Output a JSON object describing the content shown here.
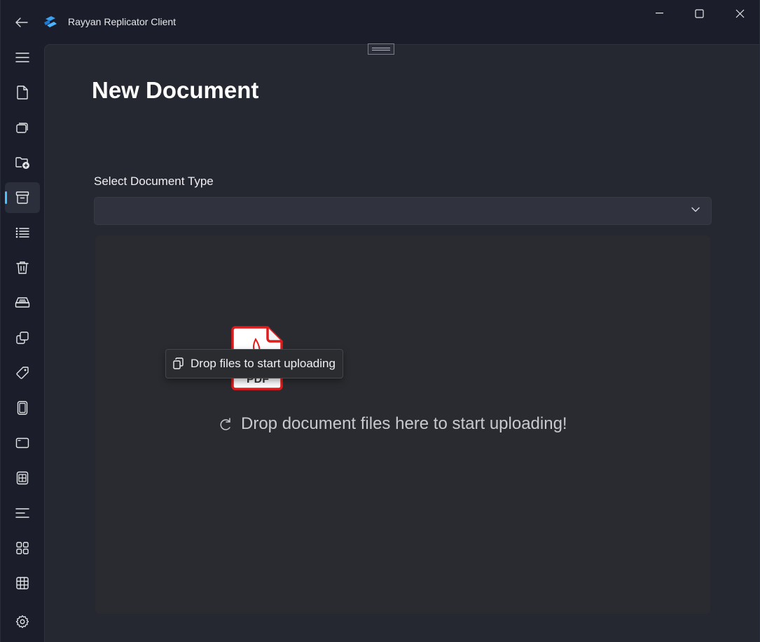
{
  "window": {
    "title": "Rayyan Replicator Client"
  },
  "sidebar": {
    "items": [
      {
        "icon": "hamburger-menu-icon"
      },
      {
        "icon": "document-icon"
      },
      {
        "icon": "documents-stack-icon"
      },
      {
        "icon": "folder-add-icon"
      },
      {
        "icon": "archive-icon",
        "active": true
      },
      {
        "icon": "bulleted-list-icon"
      },
      {
        "icon": "trash-icon"
      },
      {
        "icon": "tray-icon"
      },
      {
        "icon": "copy-windows-icon"
      },
      {
        "icon": "tag-icon"
      },
      {
        "icon": "phone-device-icon"
      },
      {
        "icon": "tablet-device-icon"
      },
      {
        "icon": "table-layout-icon"
      },
      {
        "icon": "text-align-icon"
      },
      {
        "icon": "apps-grid-icon"
      },
      {
        "icon": "grid-table-icon"
      },
      {
        "icon": "settings-gear-icon"
      }
    ],
    "accent_color": "#4cc2ff"
  },
  "page": {
    "title": "New Document"
  },
  "document_type": {
    "label": "Select Document Type",
    "value": ""
  },
  "drop_zone": {
    "message": "Drop document files here to start uploading!",
    "pdf_label": "PDF",
    "pdf_color": "#e01b1b"
  },
  "tooltip": {
    "text": "Drop files to start uploading"
  }
}
